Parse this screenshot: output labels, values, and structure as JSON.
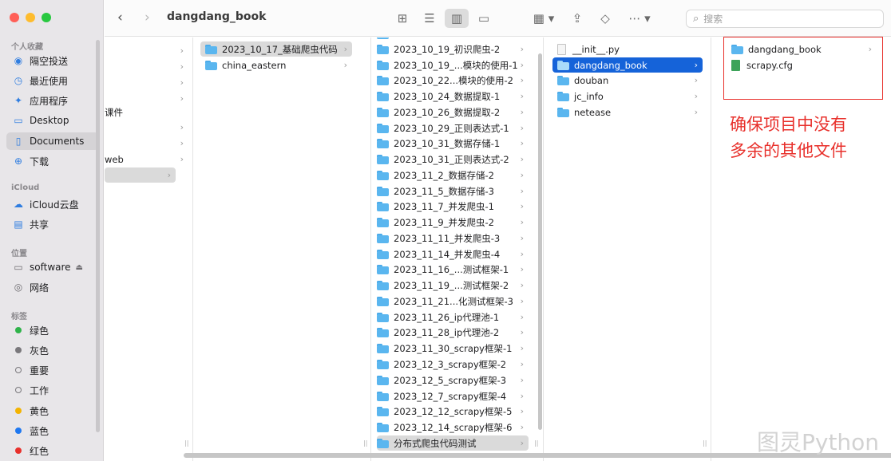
{
  "window": {
    "title": "dangdang_book",
    "traffic_lights": [
      "#ff5f57",
      "#febc2e",
      "#28c840"
    ]
  },
  "sidebar": {
    "sections": [
      {
        "label": "个人收藏",
        "items": [
          {
            "label": "隔空投送",
            "icon": "airdrop-icon"
          },
          {
            "label": "最近使用",
            "icon": "clock-icon"
          },
          {
            "label": "应用程序",
            "icon": "applications-icon"
          },
          {
            "label": "Desktop",
            "icon": "desktop-icon"
          },
          {
            "label": "Documents",
            "icon": "document-icon",
            "selected": true
          },
          {
            "label": "下载",
            "icon": "download-icon"
          }
        ]
      },
      {
        "label": "iCloud",
        "items": [
          {
            "label": "iCloud云盘",
            "icon": "cloud-icon"
          },
          {
            "label": "共享",
            "icon": "shared-folder-icon"
          }
        ]
      },
      {
        "label": "位置",
        "items": [
          {
            "label": "software",
            "icon": "drive-icon",
            "eject": "⏏"
          },
          {
            "label": "网络",
            "icon": "network-icon"
          }
        ]
      },
      {
        "label": "标签",
        "items": [
          {
            "label": "绿色",
            "color": "#2fb34a"
          },
          {
            "label": "灰色",
            "color": "#7a787c"
          },
          {
            "label": "重要",
            "color": ""
          },
          {
            "label": "工作",
            "color": ""
          },
          {
            "label": "黄色",
            "color": "#f3b300"
          },
          {
            "label": "蓝色",
            "color": "#1f78f0"
          },
          {
            "label": "红色",
            "color": "#e8302b"
          }
        ]
      }
    ]
  },
  "toolbar": {
    "search_placeholder": "搜索"
  },
  "columns": {
    "col1": [
      "",
      "",
      "",
      "",
      "课件",
      "",
      "",
      "web",
      ""
    ],
    "col2": [
      {
        "label": "2023_10_17_基础爬虫代码",
        "selected": true,
        "chevron": true
      },
      {
        "label": "china_eastern",
        "chevron": true
      }
    ],
    "col3": [
      "2023_10_19_初识爬虫-2",
      "2023_10_19_...模块的使用-1",
      "2023_10_22...模块的使用-2",
      "2023_10_24_数据提取-1",
      "2023_10_26_数据提取-2",
      "2023_10_29_正则表达式-1",
      "2023_10_31_数据存储-1",
      "2023_10_31_正则表达式-2",
      "2023_11_2_数据存储-2",
      "2023_11_5_数据存储-3",
      "2023_11_7_并发爬虫-1",
      "2023_11_9_并发爬虫-2",
      "2023_11_11_并发爬虫-3",
      "2023_11_14_并发爬虫-4",
      "2023_11_16_...测试框架-1",
      "2023_11_19_...测试框架-2",
      "2023_11_21...化测试框架-3",
      "2023_11_26_ip代理池-1",
      "2023_11_28_ip代理池-2",
      "2023_11_30_scrapy框架-1",
      "2023_12_3_scrapy框架-2",
      "2023_12_5_scrapy框架-3",
      "2023_12_7_scrapy框架-4",
      "2023_12_12_scrapy框架-5",
      "2023_12_14_scrapy框架-6",
      "分布式爬虫代码测试"
    ],
    "col4": [
      {
        "label": "__init__.py",
        "type": "file"
      },
      {
        "label": "dangdang_book",
        "type": "folder",
        "selected": true
      },
      {
        "label": "douban",
        "type": "folder"
      },
      {
        "label": "jc_info",
        "type": "folder"
      },
      {
        "label": "netease",
        "type": "folder"
      }
    ],
    "col5": [
      {
        "label": "dangdang_book",
        "type": "folder"
      },
      {
        "label": "scrapy.cfg",
        "type": "cfg"
      }
    ]
  },
  "annotation": {
    "line1": "确保项目中没有",
    "line2": "多余的其他文件"
  },
  "watermark": "图灵Python"
}
